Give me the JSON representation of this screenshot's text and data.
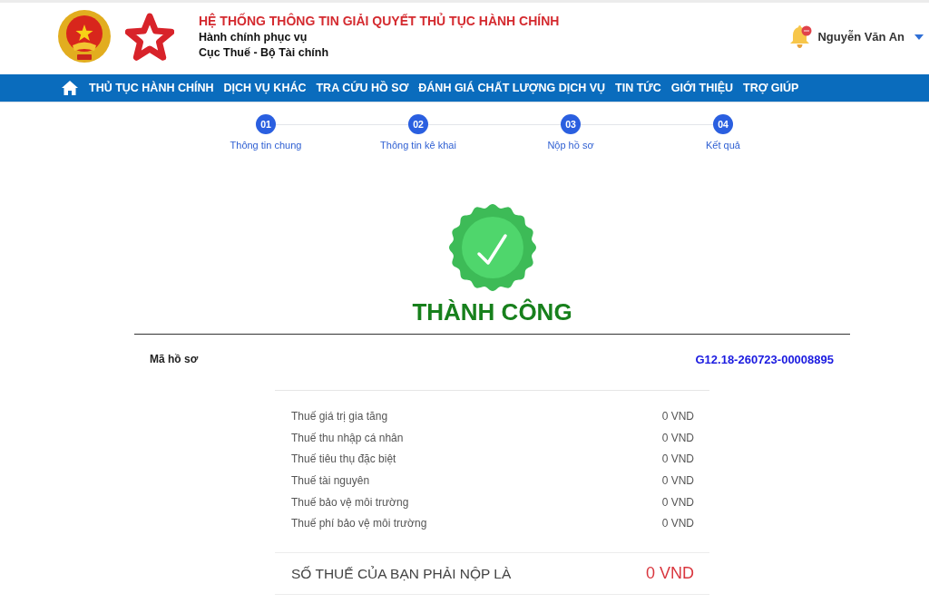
{
  "header": {
    "title": "HỆ THỐNG THÔNG TIN GIẢI QUYẾT THỦ TỤC HÀNH CHÍNH",
    "subtitles": [
      "Hành chính phục vụ",
      "Cục Thuế - Bộ Tài chính"
    ],
    "user": {
      "name": "Nguyễn Văn An"
    }
  },
  "nav": {
    "items": [
      "THỦ TỤC HÀNH CHÍNH",
      "DỊCH VỤ KHÁC",
      "TRA CỨU HỒ SƠ",
      "ĐÁNH GIÁ CHẤT LƯỢNG DỊCH VỤ",
      "TIN TỨC",
      "GIỚI THIỆU",
      "TRỢ GIÚP"
    ]
  },
  "steps": [
    {
      "number": "01",
      "label": "Thông tin chung"
    },
    {
      "number": "02",
      "label": "Thông tin kê khai"
    },
    {
      "number": "03",
      "label": "Nộp hồ sơ"
    },
    {
      "number": "04",
      "label": "Kết quả"
    }
  ],
  "result": {
    "kind": "success",
    "status": "THÀNH CÔNG"
  },
  "record": {
    "label": "Mã hồ sơ",
    "value": "G12.18-260723-00008895"
  },
  "taxes": [
    {
      "name": "Thuế giá trị gia tăng",
      "amount": "0 VND"
    },
    {
      "name": "Thuế thu nhập cá nhân",
      "amount": "0 VND"
    },
    {
      "name": "Thuế tiêu thụ đặc biệt",
      "amount": "0 VND"
    },
    {
      "name": "Thuế tài nguyên",
      "amount": "0 VND"
    },
    {
      "name": "Thuế bảo vệ môi trường",
      "amount": "0 VND"
    },
    {
      "name": "Thuế phí bảo vệ môi trường",
      "amount": "0 VND"
    }
  ],
  "total": {
    "label": "SỐ THUẾ CỦA BẠN PHẢI NỘP LÀ",
    "amount": "0 VND"
  }
}
